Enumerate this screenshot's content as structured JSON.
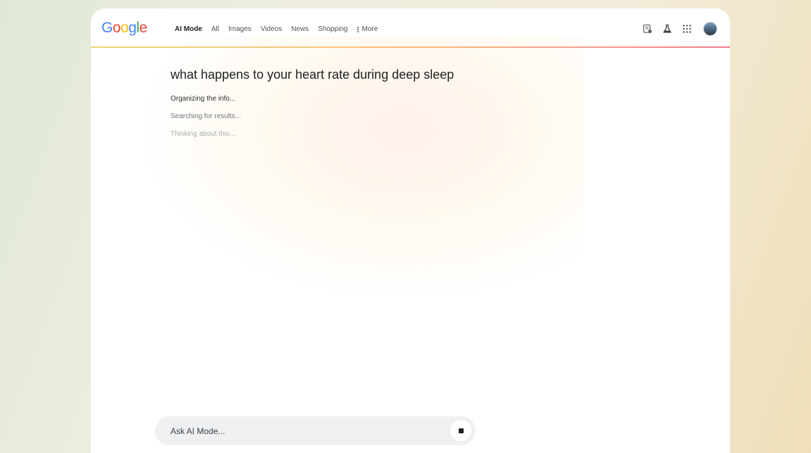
{
  "logo": {
    "letters": [
      "G",
      "o",
      "o",
      "g",
      "l",
      "e"
    ]
  },
  "nav": {
    "tabs": [
      {
        "label": "AI Mode",
        "active": true
      },
      {
        "label": "All"
      },
      {
        "label": "Images"
      },
      {
        "label": "Videos"
      },
      {
        "label": "News"
      },
      {
        "label": "Shopping"
      }
    ],
    "more_label": "More"
  },
  "header_icons": [
    "notes-icon",
    "labs-flask-icon",
    "apps-grid-icon",
    "account-avatar"
  ],
  "main": {
    "query": "what happens to your heart rate during deep sleep",
    "status_lines": [
      "Organizing the info...",
      "Searching for results...",
      "Thinking about this..."
    ]
  },
  "ask": {
    "placeholder": "Ask AI Mode..."
  },
  "colors": {
    "google_blue": "#4285f4",
    "google_red": "#ea4335",
    "google_yellow": "#fbbc05",
    "google_green": "#34a853"
  }
}
